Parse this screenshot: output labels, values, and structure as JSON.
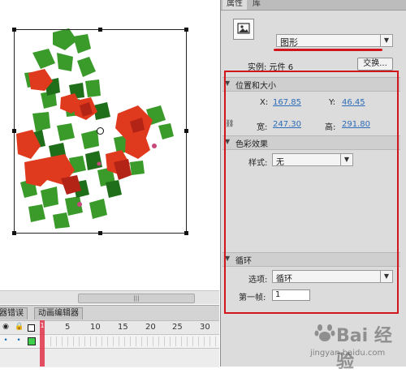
{
  "stage": {
    "art_label": "flower graphic"
  },
  "timeline": {
    "tabs": [
      "器错误",
      "动画编辑器"
    ],
    "frame_numbers": [
      "5",
      "10",
      "15",
      "20",
      "25",
      "30"
    ],
    "playhead_label": "1"
  },
  "panel": {
    "tabs": [
      "属性",
      "库"
    ],
    "symbol_type": "图形",
    "instance_label": "实例: 元件 6",
    "swap_button": "交换...",
    "position_section": "位置和大小",
    "x_label": "X:",
    "x_value": "167.85",
    "y_label": "Y:",
    "y_value": "46.45",
    "w_label": "宽:",
    "w_value": "247.30",
    "h_label": "高:",
    "h_value": "291.80",
    "color_section": "色彩效果",
    "style_label": "样式:",
    "style_value": "无",
    "loop_section": "循环",
    "options_label": "选项:",
    "options_value": "循环",
    "first_frame_label": "第一帧:",
    "first_frame_value": "1"
  },
  "watermark": {
    "text": "Bai 经验",
    "url": "jingyan.baidu.com"
  },
  "colors": {
    "highlight": "#d2141c",
    "link": "#2c6cb8",
    "playhead": "#e0314a"
  }
}
